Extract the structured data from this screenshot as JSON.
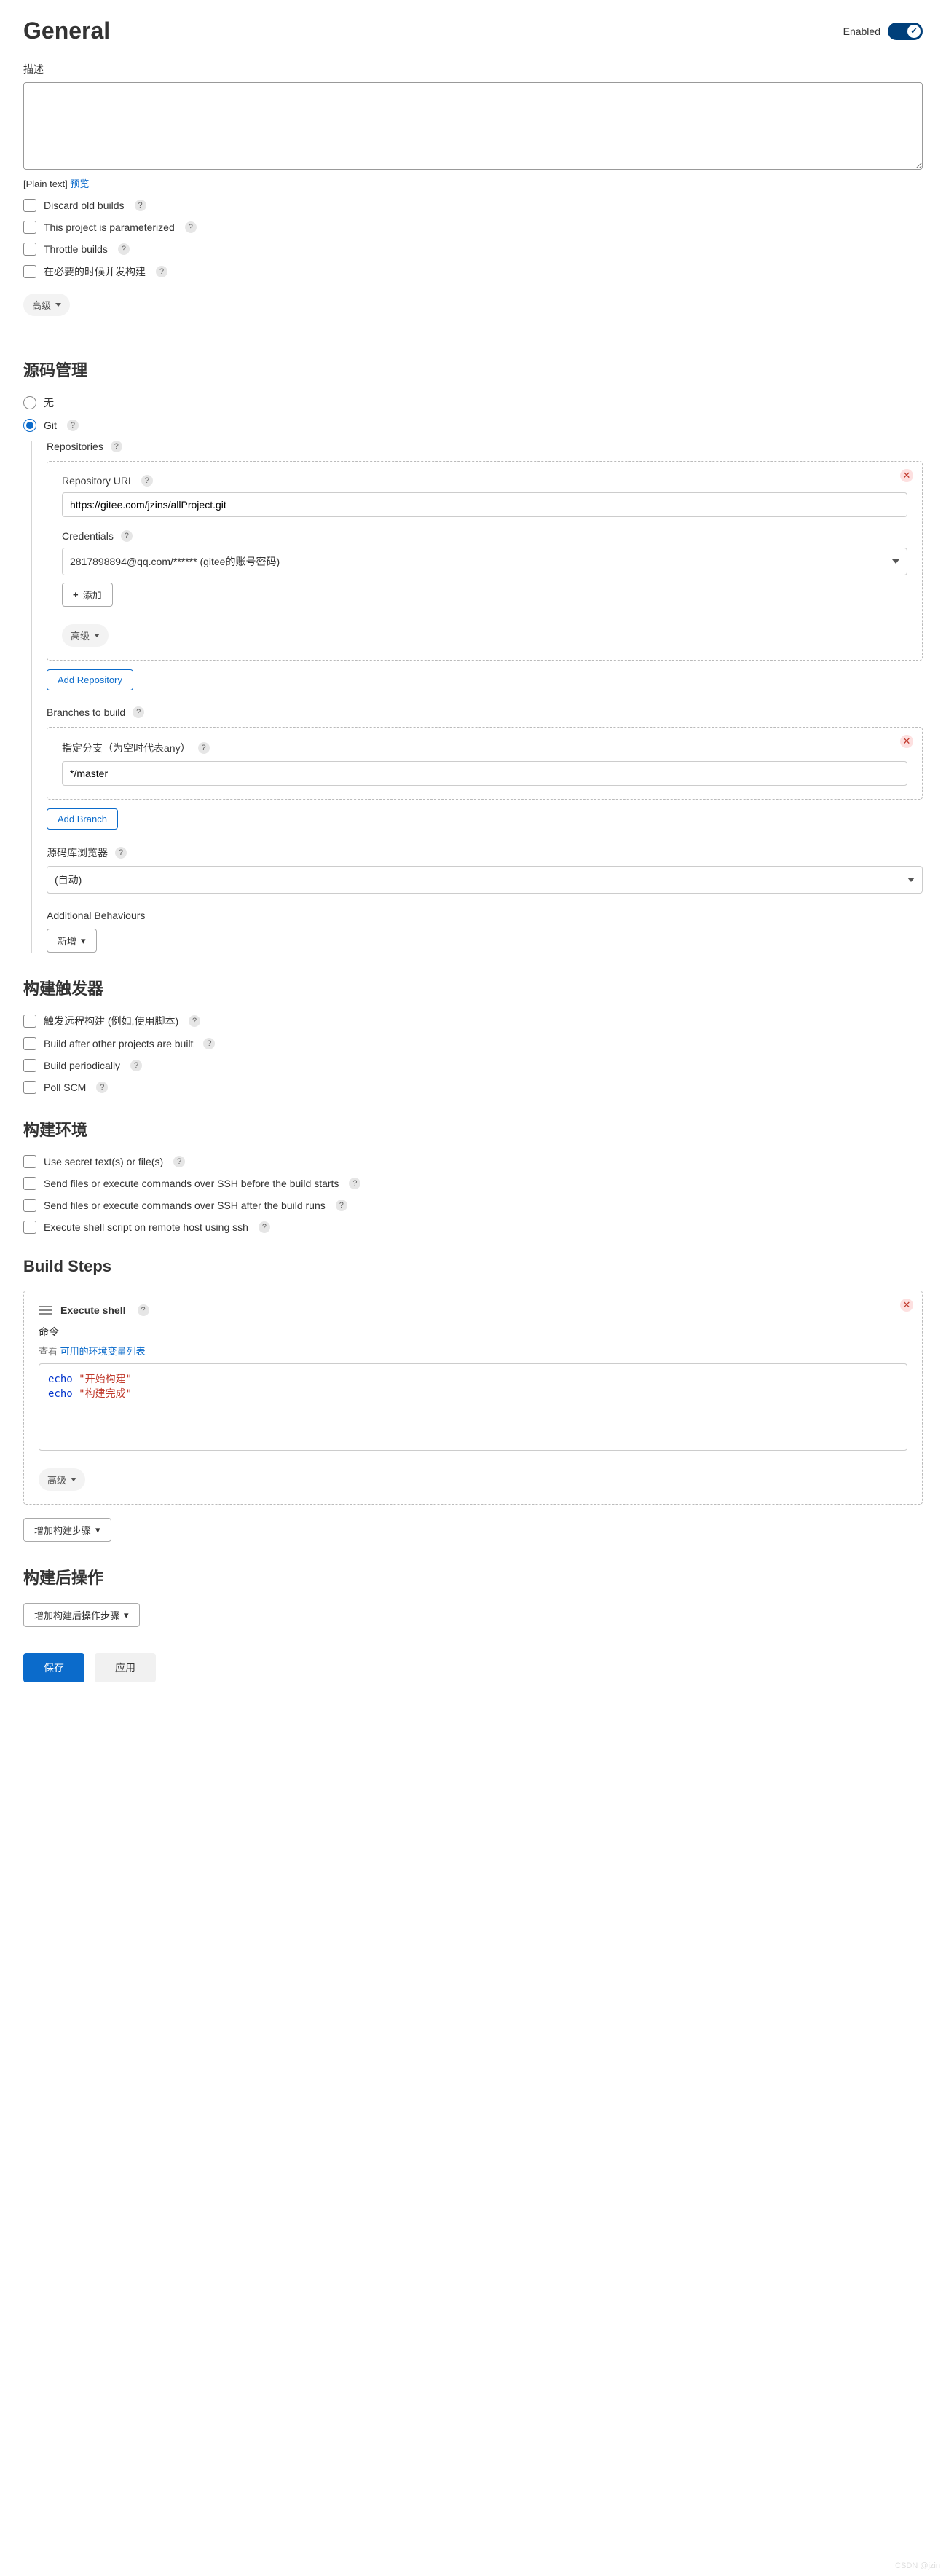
{
  "header": {
    "title": "General",
    "enabled_label": "Enabled"
  },
  "desc": {
    "label": "描述",
    "subtext_prefix": "[Plain text] ",
    "preview_link": "预览"
  },
  "general_options": {
    "discard": "Discard old builds",
    "parameterized": "This project is parameterized",
    "throttle": "Throttle builds",
    "concurrent": "在必要的时候并发构建",
    "advanced": "高级"
  },
  "scm": {
    "heading": "源码管理",
    "none": "无",
    "git": "Git",
    "repositories_label": "Repositories",
    "repo_url_label": "Repository URL",
    "repo_url_value": "https://gitee.com/jzins/allProject.git",
    "credentials_label": "Credentials",
    "credentials_value": "2817898894@qq.com/****** (gitee的账号密码)",
    "add_btn": "添加",
    "advanced": "高级",
    "add_repository": "Add Repository",
    "branches_label": "Branches to build",
    "branch_spec_label": "指定分支（为空时代表any）",
    "branch_value": "*/master",
    "add_branch": "Add Branch",
    "browser_label": "源码库浏览器",
    "browser_value": "(自动)",
    "additional_label": "Additional Behaviours",
    "additional_btn": "新增"
  },
  "triggers": {
    "heading": "构建触发器",
    "remote": "触发远程构建 (例如,使用脚本)",
    "after_other": "Build after other projects are built",
    "periodic": "Build periodically",
    "poll": "Poll SCM"
  },
  "env": {
    "heading": "构建环境",
    "secret": "Use secret text(s) or file(s)",
    "ssh_before": "Send files or execute commands over SSH before the build starts",
    "ssh_after": "Send files or execute commands over SSH after the build runs",
    "remote_shell": "Execute shell script on remote host using ssh"
  },
  "build": {
    "heading": "Build Steps",
    "step_title": "Execute shell",
    "command_label": "命令",
    "lookup_prefix": "查看 ",
    "lookup_link": "可用的环境变量列表",
    "shell_lines": [
      {
        "kw": "echo",
        "str": "\"开始构建\""
      },
      {
        "kw": "echo",
        "str": "\"构建完成\""
      }
    ],
    "advanced": "高级",
    "add_step": "增加构建步骤"
  },
  "post": {
    "heading": "构建后操作",
    "add_step": "增加构建后操作步骤"
  },
  "footer": {
    "save": "保存",
    "apply": "应用"
  },
  "watermark": "CSDN @jzin"
}
